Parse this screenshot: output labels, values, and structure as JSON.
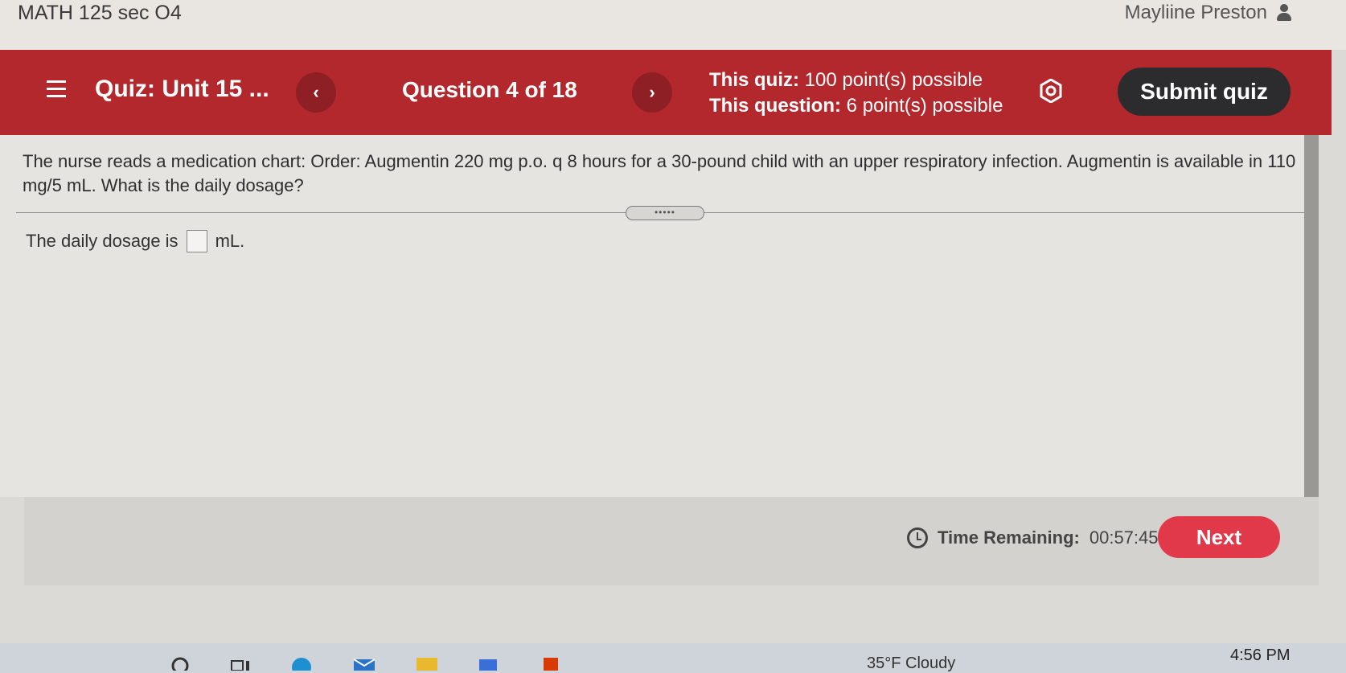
{
  "header": {
    "course_title": "MATH 125 sec O4",
    "user_name": "Mayliine Preston"
  },
  "quiz_bar": {
    "quiz_title": "Quiz: Unit 15 ...",
    "prev_label": "‹",
    "question_counter": "Question 4 of 18",
    "next_label": "›",
    "quiz_points_label": "This quiz:",
    "quiz_points_value": "100 point(s) possible",
    "question_points_label": "This question:",
    "question_points_value": "6 point(s) possible",
    "submit_label": "Submit quiz"
  },
  "question": {
    "text": "The nurse reads a medication chart: Order: Augmentin 220 mg p.o. q 8 hours for a 30-pound child with an upper respiratory infection. Augmentin is available in 110 mg/5 mL. What is the daily dosage?",
    "handle_label": "•••••",
    "answer_prefix": "The daily dosage is",
    "answer_value": "",
    "answer_suffix": "mL."
  },
  "footer": {
    "timer_label": "Time Remaining:",
    "timer_value": "00:57:45",
    "next_label": "Next"
  },
  "taskbar": {
    "weather": "35°F Cloudy",
    "time": "4:56 PM"
  },
  "colors": {
    "quiz_bar": "#b3282d",
    "submit_button": "#2c2c2e",
    "next_button": "#e2394a"
  }
}
